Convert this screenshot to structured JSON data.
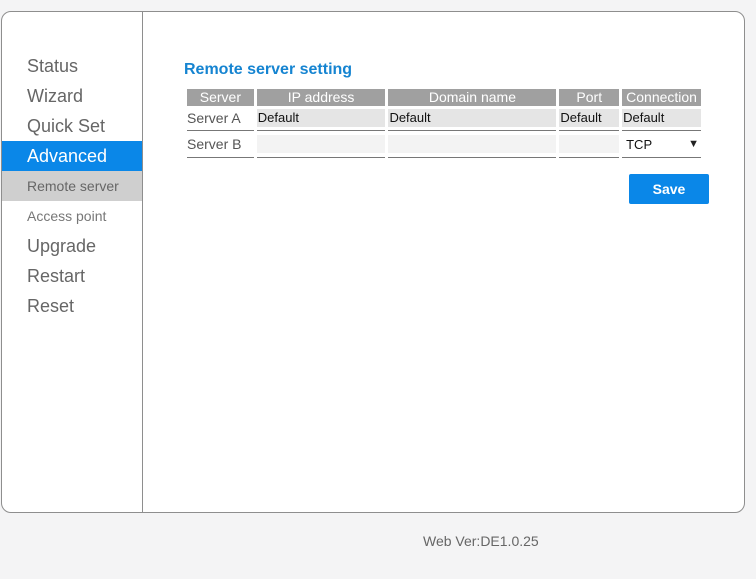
{
  "sidebar": {
    "items": [
      {
        "label": "Status"
      },
      {
        "label": "Wizard"
      },
      {
        "label": "Quick Set"
      },
      {
        "label": "Advanced"
      },
      {
        "label": "Remote server"
      },
      {
        "label": "Access point"
      },
      {
        "label": "Upgrade"
      },
      {
        "label": "Restart"
      },
      {
        "label": "Reset"
      }
    ]
  },
  "main": {
    "title": "Remote server setting",
    "table": {
      "headers": [
        "Server",
        "IP address",
        "Domain name",
        "Port",
        "Connection"
      ],
      "rows": [
        {
          "label": "Server A",
          "ip": "Default",
          "domain": "Default",
          "port": "Default",
          "connection": "Default"
        },
        {
          "label": "Server B",
          "ip": "",
          "domain": "",
          "port": "",
          "connection": "TCP"
        }
      ]
    },
    "save_label": "Save"
  },
  "footer": {
    "version": "Web Ver:DE1.0.25"
  },
  "colors": {
    "accent": "#0a87e8",
    "title": "#1584d1",
    "header_bg": "#a0a0a0",
    "selected_sub_bg": "#cfcfcf"
  }
}
